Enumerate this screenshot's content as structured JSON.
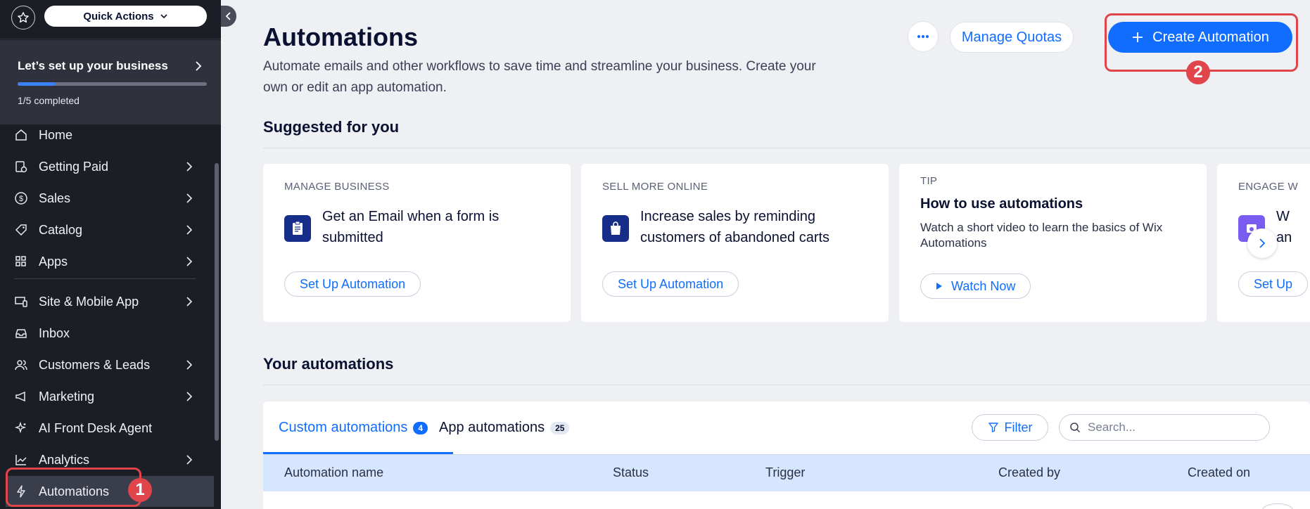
{
  "sidebar": {
    "quick_actions_label": "Quick Actions",
    "setup": {
      "title": "Let’s set up your business",
      "progress_fraction": 0.2,
      "completed_text": "1/5 completed"
    },
    "items": [
      {
        "label": "Home",
        "icon": "home-icon",
        "has_chevron": false
      },
      {
        "label": "Getting Paid",
        "icon": "payment-icon",
        "has_chevron": true
      },
      {
        "label": "Sales",
        "icon": "dollar-icon",
        "has_chevron": true
      },
      {
        "label": "Catalog",
        "icon": "tag-icon",
        "has_chevron": true
      },
      {
        "label": "Apps",
        "icon": "apps-icon",
        "has_chevron": true
      },
      {
        "label": "Site & Mobile App",
        "icon": "devices-icon",
        "has_chevron": true
      },
      {
        "label": "Inbox",
        "icon": "inbox-icon",
        "has_chevron": false
      },
      {
        "label": "Customers & Leads",
        "icon": "people-icon",
        "has_chevron": true
      },
      {
        "label": "Marketing",
        "icon": "megaphone-icon",
        "has_chevron": true
      },
      {
        "label": "AI Front Desk Agent",
        "icon": "sparkle-icon",
        "has_chevron": false
      },
      {
        "label": "Analytics",
        "icon": "chart-icon",
        "has_chevron": true
      },
      {
        "label": "Automations",
        "icon": "lightning-icon",
        "has_chevron": false,
        "active": true
      }
    ]
  },
  "annotations": {
    "badge_1": "1",
    "badge_2": "2",
    "color": "#e0454b"
  },
  "header": {
    "title": "Automations",
    "description": "Automate emails and other workflows to save time and streamline your business. Create your own or edit an app automation.",
    "more_icon": "more-horizontal-icon",
    "manage_quotas_label": "Manage Quotas",
    "create_label": "Create Automation"
  },
  "suggested": {
    "title": "Suggested for you",
    "cards": [
      {
        "category": "MANAGE BUSINESS",
        "text": "Get an Email when a form is submitted",
        "icon": "clipboard-icon",
        "button": "Set Up Automation"
      },
      {
        "category": "SELL MORE ONLINE",
        "text": "Increase sales by reminding customers of abandoned carts",
        "icon": "shopping-bag-icon",
        "button": "Set Up Automation"
      },
      {
        "category": "TIP",
        "title": "How to use automations",
        "description": "Watch a short video to learn the basics of Wix Automations",
        "button": "Watch Now"
      },
      {
        "category": "ENGAGE W",
        "text_partial_1": "W",
        "text_partial_2": "an",
        "button": "Set Up"
      }
    ]
  },
  "your_automations": {
    "title": "Your automations",
    "tabs": [
      {
        "label": "Custom automations",
        "count": "4",
        "active": true
      },
      {
        "label": "App automations",
        "count": "25",
        "active": false
      }
    ],
    "filter_label": "Filter",
    "search_placeholder": "Search...",
    "columns": [
      "Automation name",
      "Status",
      "Trigger",
      "Created by",
      "Created on"
    ]
  },
  "colors": {
    "accent": "#116dff",
    "sidebar_bg": "#1c1e26",
    "page_bg": "#eef0f4",
    "table_header_bg": "#d6e6fe"
  }
}
